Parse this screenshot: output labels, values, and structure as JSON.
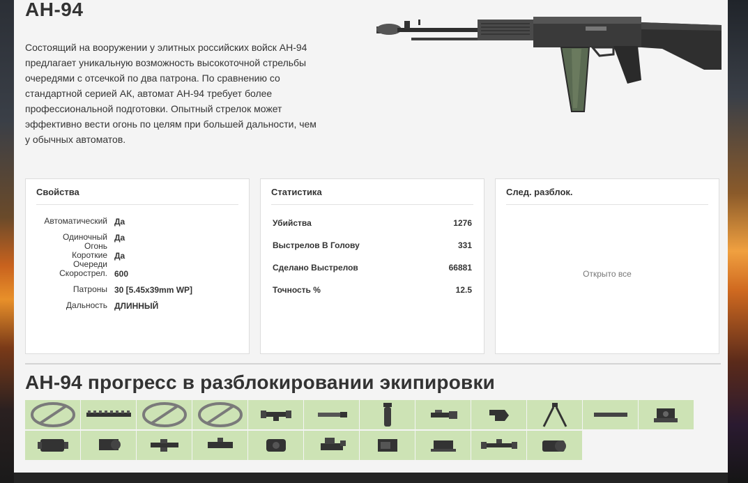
{
  "weapon": {
    "title": "АН-94",
    "description": "Состоящий на вооружении у элитных российских войск АН-94 предлагает уникальную возможность высокоточной стрельбы очередями с отсечкой по два патрона. По сравнению со стандартной серией АК, автомат АН-94 требует более профессиональной подготовки. Опытный стрелок может эффективно вести огонь по целям при большей дальности, чем у обычных автоматов.",
    "image_icon": "assault-rifle-icon"
  },
  "properties": {
    "title": "Свойства",
    "rows": [
      {
        "label": "Автоматический",
        "value": "Да"
      },
      {
        "label": "Одиночный Огонь",
        "value": "Да"
      },
      {
        "label": "Короткие Очереди",
        "value": "Да"
      },
      {
        "label": "Скорострел.",
        "value": "600"
      },
      {
        "label": "Патроны",
        "value": "30 [5.45x39mm WP]"
      },
      {
        "label": "Дальность",
        "value": "ДЛИННЫЙ"
      }
    ]
  },
  "statistics": {
    "title": "Статистика",
    "rows": [
      {
        "label": "Убийства",
        "value": "1276"
      },
      {
        "label": "Выстрелов В Голову",
        "value": "331"
      },
      {
        "label": "Сделано Выстрелов",
        "value": "66881"
      },
      {
        "label": "Точность %",
        "value": "12.5"
      }
    ]
  },
  "next_unlock": {
    "title": "След. разблок.",
    "text": "Открыто все"
  },
  "progress": {
    "title": "АН-94 прогресс в разблокировании экипировки",
    "items": [
      "none-slot-icon",
      "rail-icon",
      "none-slot-icon",
      "none-slot-icon",
      "scope-icon",
      "silencer-icon",
      "foregrip-icon",
      "flashlight-icon",
      "laser-sight-icon",
      "bipod-icon",
      "heavy-barrel-icon",
      "red-dot-sight-icon",
      "ir-scope-icon",
      "pka-scope-icon",
      "acog-scope-icon",
      "pks-scope-icon",
      "reflex-sight-icon",
      "kobra-sight-icon",
      "holo-sight-icon",
      "tactical-light-icon",
      "rifle-scope-icon",
      "ballistic-scope-icon"
    ]
  }
}
